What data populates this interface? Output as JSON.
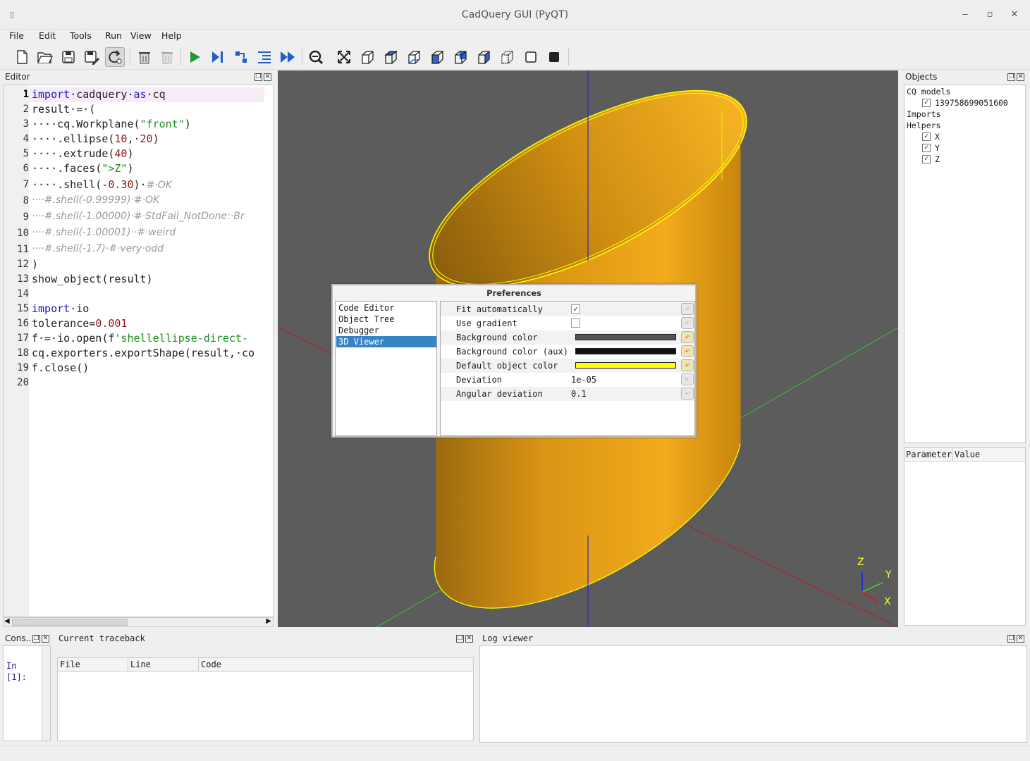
{
  "window": {
    "title": "CadQuery GUI (PyQT)",
    "min": "‒",
    "max": "▫",
    "close": "✕",
    "app_icon": "▯"
  },
  "menu": [
    "File",
    "Edit",
    "Tools",
    "Run",
    "View",
    "Help"
  ],
  "toolbar_icons": [
    "new-file-icon",
    "open-file-icon",
    "save-icon",
    "save-as-icon",
    "autoreload-icon",
    "clear-icon",
    "delete-icon",
    "run-icon",
    "debug-icon",
    "step-icon",
    "step-in-icon",
    "continue-icon",
    "zoom-icon",
    "fit-icon",
    "iso-view-icon",
    "top-view-icon",
    "bottom-view-icon",
    "front-view-icon",
    "back-view-icon",
    "left-view-icon",
    "right-view-icon",
    "wireframe-icon",
    "shaded-icon"
  ],
  "editor": {
    "title": "Editor",
    "lines": [
      {
        "n": "1"
      },
      {
        "n": "2"
      },
      {
        "n": "3"
      },
      {
        "n": "4"
      },
      {
        "n": "5"
      },
      {
        "n": "6"
      },
      {
        "n": "7"
      },
      {
        "n": "8"
      },
      {
        "n": "9"
      },
      {
        "n": "10"
      },
      {
        "n": "11"
      },
      {
        "n": "12"
      },
      {
        "n": "13"
      },
      {
        "n": "14"
      },
      {
        "n": "15"
      },
      {
        "n": "16"
      },
      {
        "n": "17"
      },
      {
        "n": "18"
      },
      {
        "n": "19"
      },
      {
        "n": "20"
      }
    ],
    "code": {
      "l1_kw": "import",
      "l1_rest": "·cadquery·",
      "l1_as": "as",
      "l1_tail": "·cq",
      "l2": "result·=·(",
      "l3_pre": "····cq.Workplane(",
      "l3_str": "\"front\"",
      "l3_post": ")",
      "l4_pre": "····.ellipse(",
      "l4_n1": "10",
      "l4_mid": ",·",
      "l4_n2": "20",
      "l4_post": ")",
      "l5_pre": "····.extrude(",
      "l5_n": "40",
      "l5_post": ")",
      "l6_pre": "····.faces(",
      "l6_str": "\">Z\"",
      "l6_post": ")",
      "l7_pre": "····.shell(-",
      "l7_n": "0.30",
      "l7_post": ")·",
      "l7_cm": "#·OK",
      "l8": "····#.shell(-0.99999)·#·OK",
      "l9": "····#.shell(-1.00000)·#·StdFail_NotDone:·Br",
      "l10": "····#.shell(-1.00001)··#·weird",
      "l11": "····#.shell(-1.7)·#·very·odd",
      "l12": ")",
      "l13": "show_object(result)",
      "l15_kw": "import",
      "l15_rest": "·io",
      "l16_pre": "tolerance=",
      "l16_n": "0.001",
      "l17_pre": "f·=·io.open(f",
      "l17_str": "'shellellipse-direct-",
      "l18": "cq.exporters.exportShape(result,·co",
      "l19": "f.close()"
    }
  },
  "viewer": {
    "axis_z": "Z",
    "axis_y": "Y",
    "axis_x": "X",
    "colors": {
      "background": "#5c5c5c",
      "object": "#f0a818",
      "edge": "#ffff00"
    }
  },
  "preferences": {
    "title": "Preferences",
    "categories": [
      "Code Editor",
      "Object Tree",
      "Debugger",
      "3D Viewer"
    ],
    "selected": "3D Viewer",
    "rows": [
      {
        "name": "Fit automatically",
        "check": "✓"
      },
      {
        "name": "Use gradient",
        "check": ""
      },
      {
        "name": "Background color",
        "color": "#555555"
      },
      {
        "name": "Background color (aux)",
        "color": "#111111"
      },
      {
        "name": "Default object color",
        "color": "#ffff00"
      },
      {
        "name": "Deviation",
        "value": "1e-05"
      },
      {
        "name": "Angular deviation",
        "value": "0.1"
      }
    ],
    "reset_icon": "↶"
  },
  "objects": {
    "title": "Objects",
    "cq_models": "CQ models",
    "model_id": "139758699051600",
    "imports": "Imports",
    "helpers": "Helpers",
    "helper_items": [
      "X",
      "Y",
      "Z"
    ],
    "check": "✓"
  },
  "params": {
    "col_param": "Parameter",
    "col_value": "Value"
  },
  "console": {
    "title": "Cons...",
    "prompt1": "In",
    "prompt2": "[1]:"
  },
  "traceback": {
    "title": "Current traceback",
    "col_file": "File",
    "col_line": "Line",
    "col_code": "Code"
  },
  "log": {
    "title": "Log viewer"
  }
}
